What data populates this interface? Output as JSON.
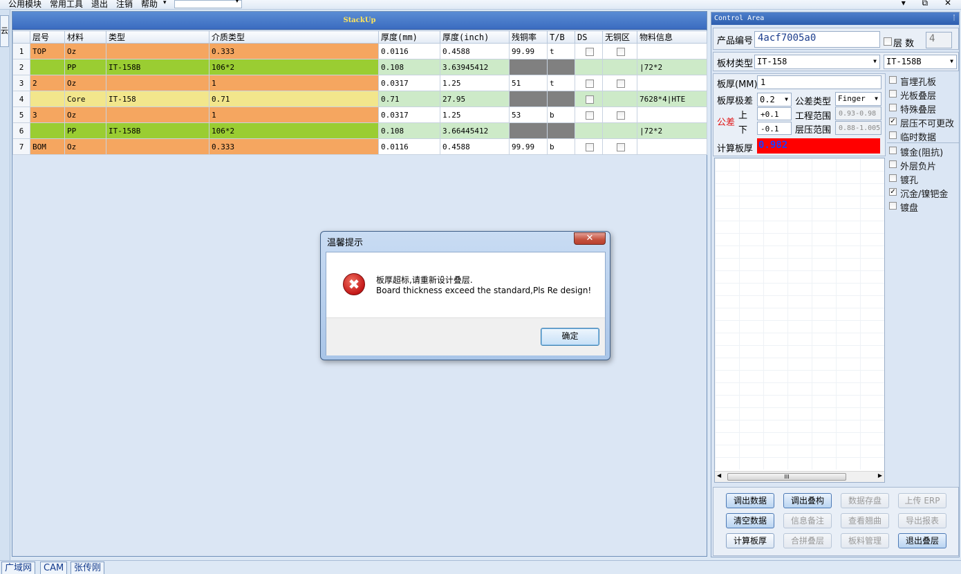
{
  "menu": {
    "items": [
      "公用模块",
      "常用工具",
      "退出",
      "注销",
      "帮助"
    ],
    "help_arrow": "▾",
    "combo_value": "",
    "window_controls": "▾ ⧉ ✕"
  },
  "left_tab": {
    "label": "云"
  },
  "stackup": {
    "title": "StackUp",
    "headers": [
      "",
      "层号",
      "材料",
      "类型",
      "介质类型",
      "厚度(mm)",
      "厚度(inch)",
      "残铜率",
      "T/B",
      "DS",
      "无铜区",
      "物料信息"
    ],
    "rows": [
      {
        "n": "1",
        "layer": "TOP",
        "material": "Oz",
        "type": "",
        "dielectric": "0.333",
        "mm": "0.0116",
        "inch": "0.4588",
        "copper": "99.99",
        "tb": "t",
        "ds": false,
        "nocopper": false,
        "info": "",
        "kind": "copper"
      },
      {
        "n": "2",
        "layer": "",
        "material": "PP",
        "type": "IT-158B",
        "dielectric": "106*2",
        "mm": "0.108",
        "inch": "3.63945412",
        "copper": "",
        "tb": "",
        "ds": null,
        "nocopper": null,
        "info": "|72*2",
        "kind": "pp"
      },
      {
        "n": "3",
        "layer": "2",
        "material": "Oz",
        "type": "",
        "dielectric": "1",
        "mm": "0.0317",
        "inch": "1.25",
        "copper": "51",
        "tb": "t",
        "ds": false,
        "nocopper": false,
        "info": "",
        "kind": "copper"
      },
      {
        "n": "4",
        "layer": "",
        "material": "Core",
        "type": "IT-158",
        "dielectric": "0.71",
        "mm": "0.71",
        "inch": "27.95",
        "copper": "",
        "tb": "",
        "ds": false,
        "nocopper": null,
        "info": "7628*4|HTE",
        "kind": "core"
      },
      {
        "n": "5",
        "layer": "3",
        "material": "Oz",
        "type": "",
        "dielectric": "1",
        "mm": "0.0317",
        "inch": "1.25",
        "copper": "53",
        "tb": "b",
        "ds": false,
        "nocopper": false,
        "info": "",
        "kind": "copper"
      },
      {
        "n": "6",
        "layer": "",
        "material": "PP",
        "type": "IT-158B",
        "dielectric": "106*2",
        "mm": "0.108",
        "inch": "3.66445412",
        "copper": "",
        "tb": "",
        "ds": null,
        "nocopper": null,
        "info": "|72*2",
        "kind": "pp"
      },
      {
        "n": "7",
        "layer": "BOM",
        "material": "Oz",
        "type": "",
        "dielectric": "0.333",
        "mm": "0.0116",
        "inch": "0.4588",
        "copper": "99.99",
        "tb": "b",
        "ds": false,
        "nocopper": false,
        "info": "",
        "kind": "copper"
      }
    ]
  },
  "control": {
    "title": "Control Area",
    "pin": "ᛙ",
    "product_label": "产品编号",
    "product_value": "4acf7005a0",
    "layers_label": "层 数",
    "layers_value": "4",
    "board_type_label": "板材类型",
    "board_type_value": "IT-158",
    "board_type_value2": "IT-158B",
    "thickness_label": "板厚(MM)",
    "thickness_value": "1",
    "tolerance_label": "板厚极差",
    "tolerance_value": "0.2",
    "tol_type_label": "公差类型",
    "tol_type_value": "Finger",
    "gongcha_label": "公差",
    "upper_label": "上",
    "lower_label": "下",
    "upper_value": "+0.1",
    "lower_value": "-0.1",
    "eng_range_label": "工程范围",
    "eng_range_value": "0.93-0.98",
    "press_range_label": "层压范围",
    "press_range_value": "0.88-1.005",
    "calc_label": "计算板厚",
    "calc_value": "0.982",
    "options_a": [
      {
        "label": "盲埋孔板",
        "checked": false
      },
      {
        "label": "光板叠层",
        "checked": false
      },
      {
        "label": "特殊叠层",
        "checked": false
      },
      {
        "label": "层压不可更改",
        "checked": true
      },
      {
        "label": "临时数据",
        "checked": false
      }
    ],
    "options_b": [
      {
        "label": "镀金(阻抗)",
        "checked": false
      },
      {
        "label": "外层负片",
        "checked": false
      },
      {
        "label": "镀孔",
        "checked": false
      },
      {
        "label": "沉金/镍钯金",
        "checked": true
      },
      {
        "label": "镀盘",
        "checked": false
      }
    ],
    "scroll_thumb": "III",
    "buttons": [
      {
        "label": "调出数据",
        "state": "hl"
      },
      {
        "label": "调出叠构",
        "state": "hl"
      },
      {
        "label": "数据存盘",
        "state": "dis"
      },
      {
        "label": "上传 ERP",
        "state": "dis"
      },
      {
        "label": "清空数据",
        "state": "hl"
      },
      {
        "label": "信息备注",
        "state": "dis"
      },
      {
        "label": "查看翘曲",
        "state": "dis"
      },
      {
        "label": "导出报表",
        "state": "dis"
      },
      {
        "label": "计算板厚",
        "state": "normal"
      },
      {
        "label": "合拼叠层",
        "state": "dis"
      },
      {
        "label": "板料管理",
        "state": "dis"
      },
      {
        "label": "退出叠层",
        "state": "hl"
      }
    ]
  },
  "status": {
    "items": [
      "广域网",
      "CAM",
      "张传刚"
    ]
  },
  "dialog": {
    "title": "温馨提示",
    "close": "✕",
    "icon": "✖",
    "message_cn": "板厚超标,请重新设计叠层.",
    "message_en": "Board thickness exceed the standard,Pls Re design!",
    "ok": "确定"
  },
  "colors": {
    "copper_row": "#f5a660",
    "pp_row": "#9acd32",
    "core_row": "#f2e68c",
    "calc_bg": "#ff0000",
    "calc_text": "#1a3cff"
  }
}
